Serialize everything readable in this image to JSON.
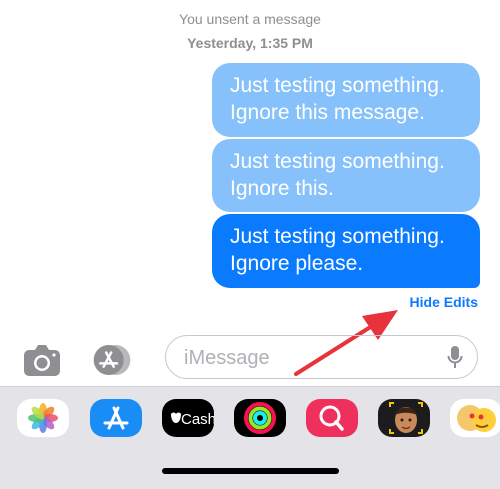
{
  "thread": {
    "unsent_notice": "You unsent a message",
    "timestamp": "Yesterday, 1:35 PM"
  },
  "messages": {
    "edit_1": {
      "line1": "Just testing something.",
      "line2": "Ignore this message."
    },
    "edit_2": {
      "line1": "Just testing something.",
      "line2": "Ignore this."
    },
    "current": {
      "line1": "Just testing something.",
      "line2": "Ignore please."
    }
  },
  "hide_edits_label": "Hide Edits",
  "compose": {
    "placeholder": "iMessage"
  },
  "app_drawer": {
    "cash_label": "Cash",
    "items": [
      "photos-app",
      "app-store-app",
      "apple-cash-app",
      "activity-app",
      "search-images-app",
      "memoji-app",
      "animoji-app"
    ]
  },
  "colors": {
    "bubble_current": "#0a7aff",
    "bubble_previous": "#87c1fb",
    "arrow": "#e8323c",
    "link": "#0a7aff"
  }
}
